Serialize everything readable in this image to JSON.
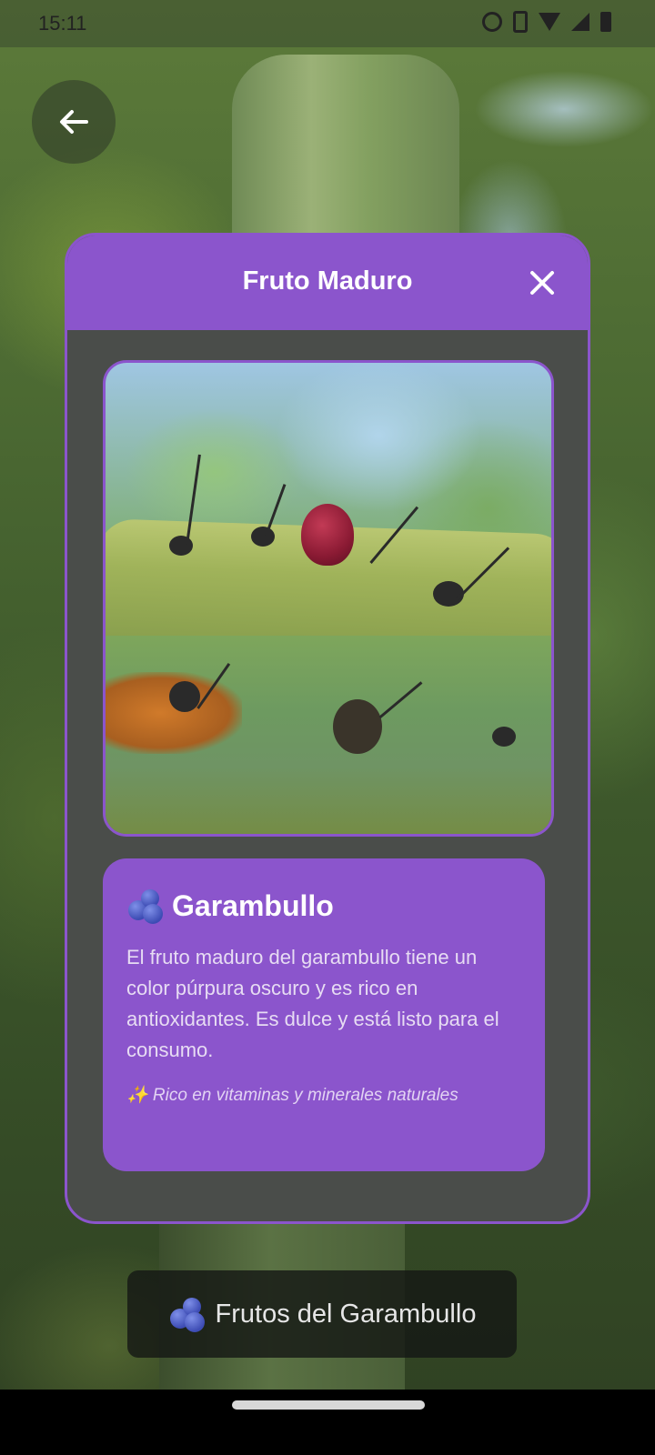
{
  "status_bar": {
    "time": "15:11",
    "icons": [
      "alarm-icon",
      "vibrate-icon",
      "wifi-icon",
      "signal-icon",
      "battery-icon"
    ]
  },
  "back_button": {
    "icon": "arrow-left-icon"
  },
  "modal": {
    "title": "Fruto Maduro",
    "close_icon": "close-icon",
    "accent_color": "#8b55cc",
    "info": {
      "icon": "blueberries-icon",
      "title": "Garambullo",
      "description": "El fruto maduro del garambullo tiene un color púrpura oscuro y es rico en antioxidantes. Es dulce y está listo para el consumo.",
      "note": "✨ Rico en vitaminas y minerales naturales"
    }
  },
  "bottom_banner": {
    "icon": "blueberries-icon",
    "label": "Frutos del Garambullo"
  }
}
